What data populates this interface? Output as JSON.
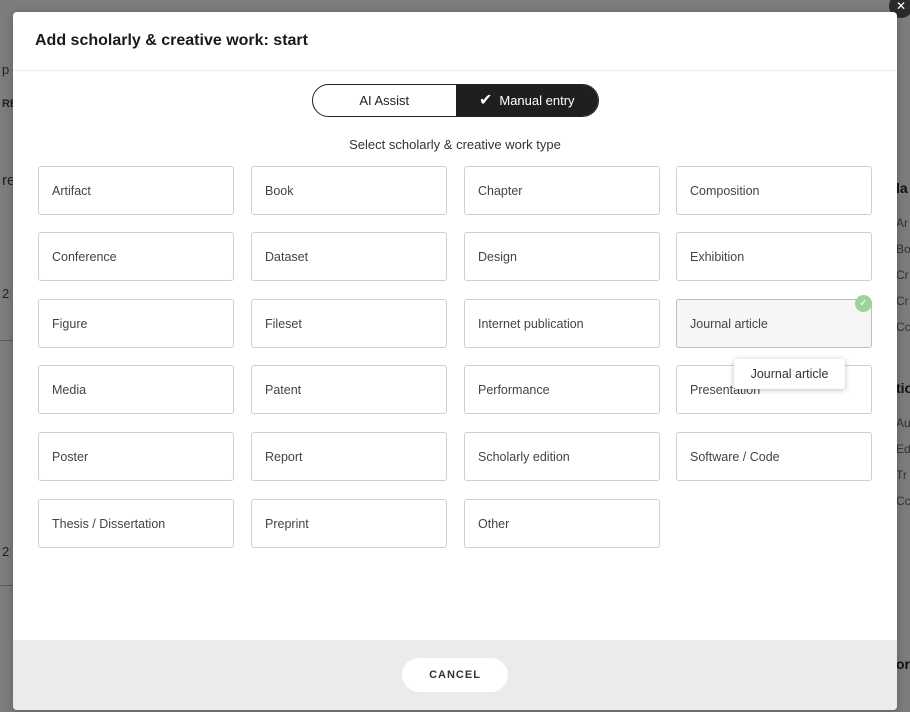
{
  "background": {
    "left_fragments": [
      "p",
      "RE",
      "re",
      "2",
      "2"
    ],
    "right_heading_1": "la",
    "right_items_1": [
      "Ar",
      "Bo",
      "Cr",
      "Cr",
      "Cc"
    ],
    "right_heading_2": "tio",
    "right_items_2": [
      "Au",
      "Ed",
      "Tr",
      "Cc"
    ],
    "right_heading_3": "or"
  },
  "modal": {
    "title": "Add scholarly & creative work: start",
    "close_icon": "close-icon",
    "toggle": {
      "options": [
        {
          "label": "AI Assist",
          "active": false
        },
        {
          "label": "Manual entry",
          "active": true
        }
      ],
      "check_icon": "✔"
    },
    "subtitle": "Select scholarly & creative work type",
    "work_types": [
      "Artifact",
      "Book",
      "Chapter",
      "Composition",
      "Conference",
      "Dataset",
      "Design",
      "Exhibition",
      "Figure",
      "Fileset",
      "Internet publication",
      "Journal article",
      "Media",
      "Patent",
      "Performance",
      "Presentation",
      "Poster",
      "Report",
      "Scholarly edition",
      "Software / Code",
      "Thesis / Dissertation",
      "Preprint",
      "Other"
    ],
    "selected_type": "Journal article",
    "tooltip": "Journal article",
    "cancel_label": "CANCEL"
  },
  "colors": {
    "accent_dark": "#1f1f1f",
    "selected_badge": "#9bd49b",
    "overlay": "#7d7d7d"
  }
}
